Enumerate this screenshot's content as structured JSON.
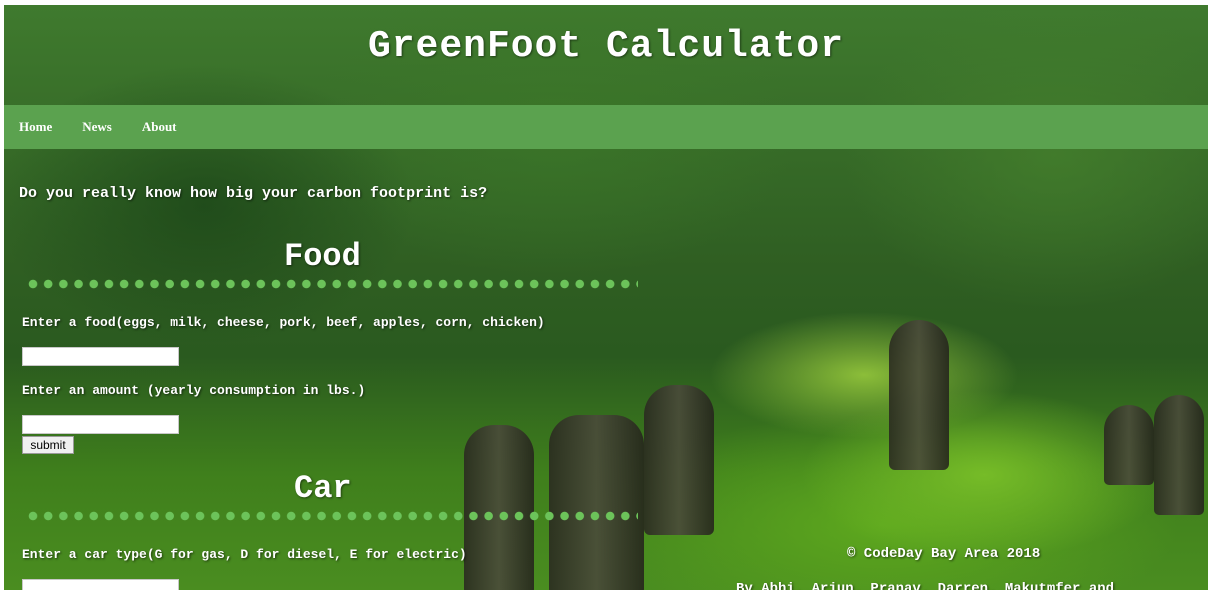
{
  "header": {
    "title": "GreenFoot Calculator"
  },
  "nav": {
    "items": [
      {
        "label": "Home"
      },
      {
        "label": "News"
      },
      {
        "label": "About"
      }
    ]
  },
  "intro": {
    "tagline": "Do you really know how big your carbon footprint is?"
  },
  "food": {
    "title": "Food",
    "food_label": "Enter a food(eggs, milk, cheese, pork, beef, apples, corn, chicken)",
    "food_value": "",
    "amount_label": "Enter an amount (yearly consumption in lbs.)",
    "amount_value": "",
    "submit_label": "submit"
  },
  "car": {
    "title": "Car",
    "type_label": "Enter a car type(G for gas, D for diesel, E for electric)",
    "type_value": ""
  },
  "footer": {
    "copyright": "© CodeDay Bay Area 2018",
    "credits": "By Abhi, Arjun, Pranav, Darren, Makutmfer and"
  },
  "colors": {
    "accent": "#5ba24f",
    "dots": "#6cc35a",
    "text": "#ffffff"
  }
}
